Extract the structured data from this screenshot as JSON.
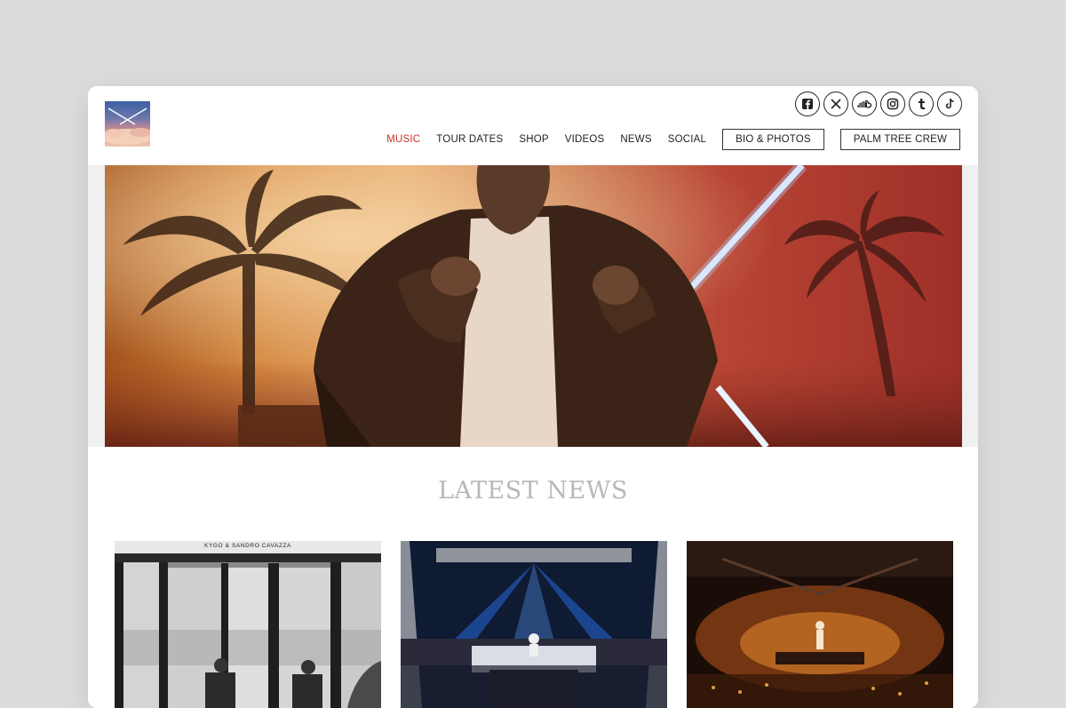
{
  "nav": {
    "items": [
      {
        "label": "MUSIC",
        "active": true
      },
      {
        "label": "TOUR DATES",
        "active": false
      },
      {
        "label": "SHOP",
        "active": false
      },
      {
        "label": "VIDEOS",
        "active": false
      },
      {
        "label": "NEWS",
        "active": false
      },
      {
        "label": "SOCIAL",
        "active": false
      }
    ],
    "buttons": [
      "BIO & PHOTOS",
      "PALM TREE CREW"
    ]
  },
  "social": [
    "facebook-icon",
    "x-icon",
    "soundcloud-icon",
    "instagram-icon",
    "tumblr-icon",
    "tiktok-icon"
  ],
  "latest_news": {
    "title": "LATEST NEWS",
    "cards": [
      {
        "caption": "KYGO & SANDRO CAVAZZA"
      },
      {
        "caption": ""
      },
      {
        "caption": ""
      }
    ]
  },
  "colors": {
    "active_nav": "#c8312a",
    "title_gray": "#b8b8b8"
  }
}
